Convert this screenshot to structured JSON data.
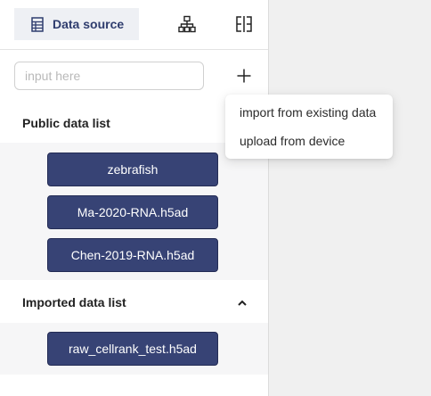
{
  "tabs": {
    "active_label": "Data source",
    "icons": [
      "table-icon",
      "hierarchy-icon",
      "split-view-icon"
    ]
  },
  "search": {
    "placeholder": "input here",
    "value": ""
  },
  "public_section": {
    "title": "Public data list",
    "items": [
      "zebrafish",
      "Ma-2020-RNA.h5ad",
      "Chen-2019-RNA.h5ad"
    ]
  },
  "imported_section": {
    "title": "Imported data list",
    "expanded": true,
    "items": [
      "raw_cellrank_test.h5ad"
    ]
  },
  "add_menu": {
    "items": [
      "import from existing data",
      "upload from device"
    ]
  },
  "colors": {
    "accent": "#374375",
    "tab_background": "#eef0f4",
    "list_background": "#f6f6f7"
  }
}
